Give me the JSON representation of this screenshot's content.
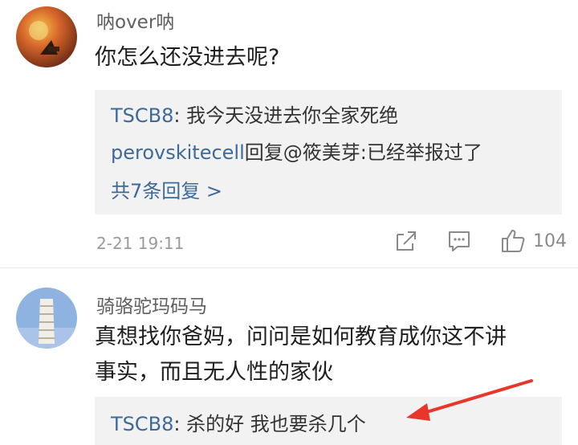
{
  "comments": [
    {
      "username": "呐over呐",
      "text": "你怎么还没进去呢?",
      "replies": [
        {
          "name": "TSCB8",
          "sep": ": ",
          "text": "我今天没进去你全家死绝"
        },
        {
          "name": "perovskitecell",
          "sep": "回复@筱美芽",
          "text": ":已经举报过了"
        }
      ],
      "more_replies": "共7条回复 >",
      "timestamp": "2-21 19:11",
      "like_count": "104"
    },
    {
      "username": "骑骆驼玛码马",
      "text_line1": "真想找你爸妈，问问是如何教育成你这不讲",
      "text_line2": "事实，而且无人性的家伙",
      "replies": [
        {
          "name": "TSCB8",
          "sep": ": ",
          "text": "杀的好 我也要杀几个"
        }
      ]
    }
  ],
  "colors": {
    "reply_name": "#3d6a99",
    "annotation_arrow": "#e8362a"
  },
  "icons": {
    "share": "share-icon",
    "comment": "comment-icon",
    "like": "thumbs-up-icon"
  }
}
